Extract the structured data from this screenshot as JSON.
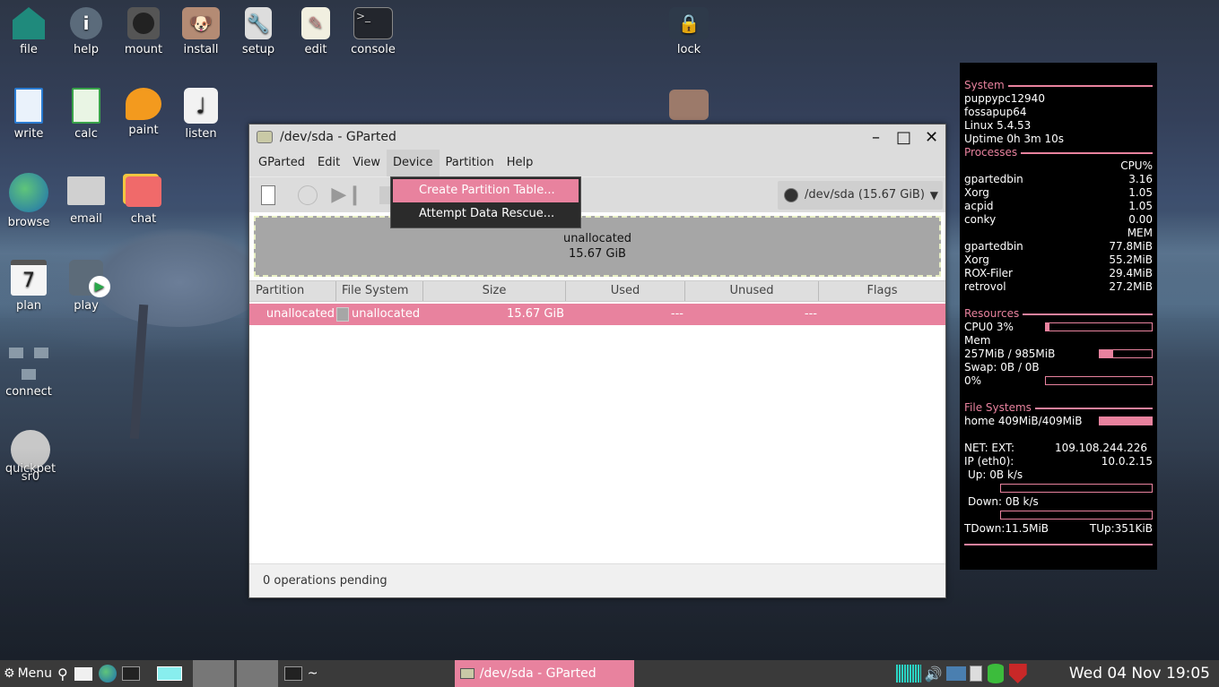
{
  "desktop": {
    "icons": [
      {
        "label": "file",
        "icon": "home-folder-icon"
      },
      {
        "label": "help",
        "icon": "info-icon"
      },
      {
        "label": "mount",
        "icon": "drive-icon"
      },
      {
        "label": "install",
        "icon": "puppy-installer-icon"
      },
      {
        "label": "setup",
        "icon": "wrench-icon"
      },
      {
        "label": "edit",
        "icon": "text-editor-icon"
      },
      {
        "label": "console",
        "icon": "terminal-icon"
      },
      {
        "label": "lock",
        "icon": "padlock-icon"
      },
      {
        "label": "write",
        "icon": "document-icon"
      },
      {
        "label": "calc",
        "icon": "spreadsheet-icon"
      },
      {
        "label": "paint",
        "icon": "palette-icon"
      },
      {
        "label": "listen",
        "icon": "music-note-icon"
      },
      {
        "label": "browse",
        "icon": "globe-icon"
      },
      {
        "label": "email",
        "icon": "envelope-icon"
      },
      {
        "label": "chat",
        "icon": "chat-bubble-icon"
      },
      {
        "label": "plan",
        "icon": "calendar-icon"
      },
      {
        "label": "play",
        "icon": "video-play-icon"
      },
      {
        "label": "connect",
        "icon": "network-icon"
      },
      {
        "label": "quickpet",
        "icon": "puppy-icon"
      },
      {
        "label": "sr0",
        "icon": "optical-drive-icon"
      }
    ],
    "calendar_day": "7"
  },
  "conky": {
    "system_title": "System",
    "hostname": "puppypc12940",
    "distro": "fossapup64",
    "kernel": "Linux 5.4.53",
    "uptime": "Uptime 0h 3m 10s",
    "processes_title": "Processes",
    "cpu_header": "CPU%",
    "cpu_procs": [
      {
        "name": "gpartedbin",
        "value": "3.16"
      },
      {
        "name": "Xorg",
        "value": "1.05"
      },
      {
        "name": "acpid",
        "value": "1.05"
      },
      {
        "name": "conky",
        "value": "0.00"
      }
    ],
    "mem_header": "MEM",
    "mem_procs": [
      {
        "name": "gpartedbin",
        "value": "77.8MiB"
      },
      {
        "name": "Xorg",
        "value": "55.2MiB"
      },
      {
        "name": "ROX-Filer",
        "value": "29.4MiB"
      },
      {
        "name": "retrovol",
        "value": "27.2MiB"
      }
    ],
    "resources_title": "Resources",
    "cpu0": "CPU0 3%",
    "cpu0_fraction": 0.03,
    "mem_label": "Mem",
    "mem_usage": "257MiB / 985MiB",
    "mem_fraction": 0.26,
    "swap": "Swap: 0B   / 0B",
    "swap_pct": "0%",
    "swap_fraction": 0,
    "fs_title": "File Systems",
    "fs_home": "home 409MiB/409MiB",
    "fs_fraction": 1.0,
    "net_ext_label": "NET: EXT:",
    "net_ext_ip": "109.108.244.226",
    "ip_label": "IP (eth0):",
    "ip_value": "10.0.2.15",
    "up": "Up: 0B   k/s",
    "down": "Down: 0B  k/s",
    "tdown": "TDown:11.5MiB",
    "tup": "TUp:351KiB",
    "accent_color": "#e8829e"
  },
  "gparted": {
    "title": "/dev/sda - GParted",
    "menu": [
      "GParted",
      "Edit",
      "View",
      "Device",
      "Partition",
      "Help"
    ],
    "active_menu": "Device",
    "device_selector": "/dev/sda (15.67 GiB)",
    "graph_label": "unallocated",
    "graph_size": "15.67 GiB",
    "columns": [
      "Partition",
      "File System",
      "Size",
      "Used",
      "Unused",
      "Flags"
    ],
    "rows": [
      {
        "partition": "unallocated",
        "filesystem": "unallocated",
        "size": "15.67 GiB",
        "used": "---",
        "unused": "---",
        "flags": ""
      }
    ],
    "status": "0 operations pending",
    "device_menu": [
      "Create Partition Table...",
      "Attempt Data Rescue..."
    ],
    "highlight_color": "#e8829e"
  },
  "taskbar": {
    "menu_label": "Menu",
    "terminal_task": "~",
    "active_task": "/dev/sda - GParted",
    "clock": "Wed 04 Nov 19:05"
  }
}
